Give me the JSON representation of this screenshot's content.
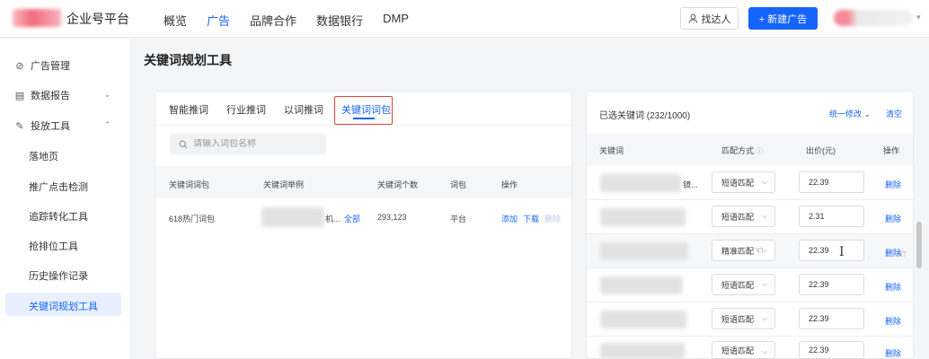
{
  "header": {
    "brand": "企业号平台",
    "nav": [
      "概览",
      "广告",
      "品牌合作",
      "数据银行",
      "DMP"
    ],
    "find_talent": "找达人",
    "new_ad": "+ 新建广告"
  },
  "sidebar": {
    "items": [
      {
        "label": "广告管理",
        "icon": "compass-icon"
      },
      {
        "label": "数据报告",
        "icon": "report-icon"
      },
      {
        "label": "投放工具",
        "icon": "tools-icon"
      }
    ],
    "sub_items": [
      "落地页",
      "推广点击检测",
      "追踪转化工具",
      "抢排位工具",
      "历史操作记录",
      "关键词规划工具"
    ]
  },
  "page": {
    "title": "关键词规划工具"
  },
  "left": {
    "tabs": [
      "智能推词",
      "行业推词",
      "以词推词",
      "关键词词包"
    ],
    "search_placeholder": "请输入词包名称",
    "columns": [
      "关键词词包",
      "关键词举例",
      "关键词个数",
      "词包",
      "操作"
    ],
    "rows": [
      {
        "name": "618热门词包",
        "example_suffix": "机...",
        "all_link": "全部",
        "count": "293,123",
        "type": "平台",
        "add": "添加",
        "download": "下载",
        "delete": "删除"
      }
    ]
  },
  "right": {
    "title": "已选关键词 (232/1000)",
    "batch_modify": "统一修改",
    "clear": "清空",
    "columns": [
      "关键词",
      "匹配方式",
      "出价(元)",
      "操作"
    ],
    "rows": [
      {
        "keyword_suffix": "镜...",
        "match": "短语匹配",
        "price": "22.39",
        "delete": "删除"
      },
      {
        "keyword_suffix": "",
        "match": "短语匹配",
        "price": "2.31",
        "delete": "删除"
      },
      {
        "keyword_suffix": "",
        "match": "精准匹配",
        "price": "22.39",
        "delete": "删除"
      },
      {
        "keyword_suffix": "",
        "match": "短语匹配",
        "price": "22.39",
        "delete": "删除"
      },
      {
        "keyword_suffix": "",
        "match": "短语匹配",
        "price": "22.39",
        "delete": "删除"
      },
      {
        "keyword_suffix": "",
        "match": "短语匹配",
        "price": "22.39",
        "delete": "删除"
      }
    ]
  },
  "colors": {
    "accent": "#1664ff",
    "highlight_box": "#e0453a"
  }
}
